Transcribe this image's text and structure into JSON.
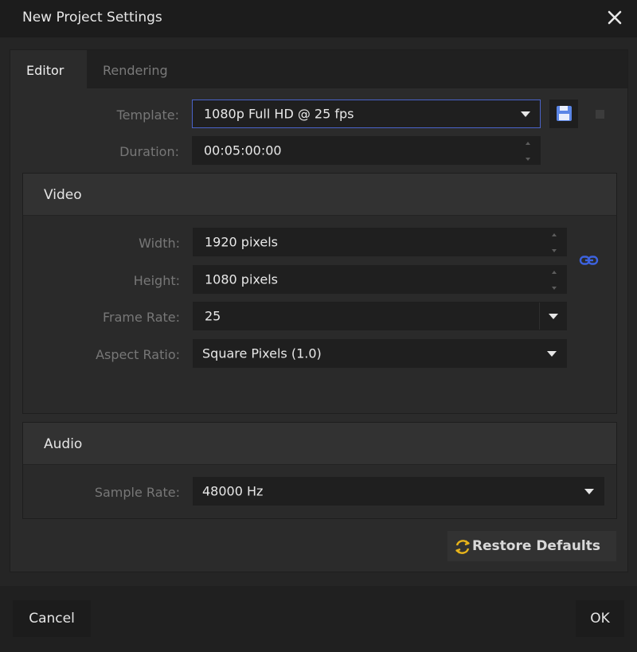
{
  "window": {
    "title": "New Project Settings"
  },
  "tabs": [
    {
      "label": "Editor",
      "active": true
    },
    {
      "label": "Rendering",
      "active": false
    }
  ],
  "editor": {
    "template": {
      "label": "Template:",
      "value": "1080p Full HD @ 25 fps"
    },
    "duration": {
      "label": "Duration:",
      "value": "00:05:00:00"
    }
  },
  "video": {
    "heading": "Video",
    "width": {
      "label": "Width:",
      "value": "1920 pixels"
    },
    "height": {
      "label": "Height:",
      "value": "1080 pixels"
    },
    "frame_rate": {
      "label": "Frame Rate:",
      "value": "25"
    },
    "aspect_ratio": {
      "label": "Aspect Ratio:",
      "value": "Square Pixels (1.0)"
    }
  },
  "audio": {
    "heading": "Audio",
    "sample_rate": {
      "label": "Sample Rate:",
      "value": "48000 Hz"
    }
  },
  "restore_defaults": "Restore Defaults",
  "footer": {
    "cancel": "Cancel",
    "ok": "OK"
  },
  "colors": {
    "focus_border": "#4a63c9",
    "link_icon": "#3d63e0",
    "save_icon": "#5b86e6",
    "restore_icon": "#e8b41a"
  },
  "icons": [
    "close-icon",
    "chevron-down-icon",
    "save-icon",
    "delete-icon",
    "link-icon",
    "restore-icon"
  ]
}
